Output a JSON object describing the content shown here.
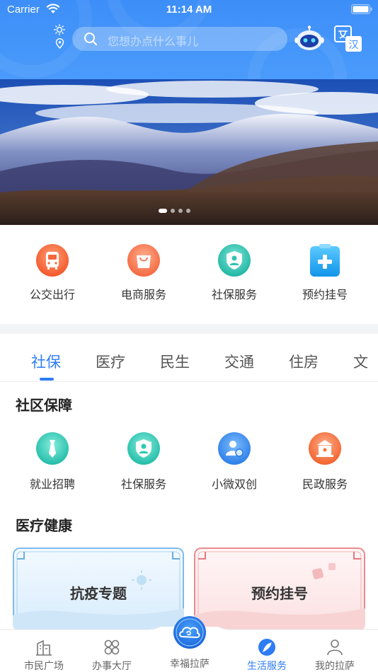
{
  "status_bar": {
    "carrier": "Carrier",
    "time": "11:14 AM"
  },
  "search": {
    "placeholder": "您想办点什么事儿"
  },
  "banner": {
    "page_count": 4,
    "active_page": 1
  },
  "quick_services": [
    {
      "label": "公交出行",
      "icon": "bus-icon",
      "color": "#f4673a"
    },
    {
      "label": "电商服务",
      "icon": "shopping-bag-icon",
      "color": "#f47a5a"
    },
    {
      "label": "社保服务",
      "icon": "shield-person-icon",
      "color": "#2fc2b0"
    },
    {
      "label": "预约挂号",
      "icon": "medical-clipboard-icon",
      "color": "#1aa4f0"
    }
  ],
  "tabs": [
    {
      "label": "社保",
      "active": true
    },
    {
      "label": "医疗",
      "active": false
    },
    {
      "label": "民生",
      "active": false
    },
    {
      "label": "交通",
      "active": false
    },
    {
      "label": "住房",
      "active": false
    },
    {
      "label": "文",
      "active": false
    }
  ],
  "community": {
    "title": "社区保障",
    "items": [
      {
        "label": "就业招聘",
        "icon": "tie-icon",
        "color": "#2ec9b3"
      },
      {
        "label": "社保服务",
        "icon": "shield-person-icon",
        "color": "#2ec9b3"
      },
      {
        "label": "小微双创",
        "icon": "user-badge-icon",
        "color": "#3d8ef0"
      },
      {
        "label": "民政服务",
        "icon": "building-icon",
        "color": "#f4733a"
      }
    ]
  },
  "health": {
    "title": "医疗健康",
    "cards": [
      {
        "label": "抗疫专题",
        "theme": "#5aa8e6"
      },
      {
        "label": "预约挂号",
        "theme": "#e85a5f"
      }
    ]
  },
  "tabbar": {
    "items": [
      {
        "label": "市民广场",
        "icon": "building-icon",
        "active": false
      },
      {
        "label": "办事大厅",
        "icon": "grid-icon",
        "active": false
      },
      {
        "label": "幸福拉萨",
        "icon": "cloud-emblem-icon",
        "active": false
      },
      {
        "label": "生活服务",
        "icon": "feather-icon",
        "active": true
      },
      {
        "label": "我的拉萨",
        "icon": "person-icon",
        "active": false
      }
    ]
  },
  "colors": {
    "primary": "#2e7cf6",
    "header": "#3d8ef8"
  }
}
